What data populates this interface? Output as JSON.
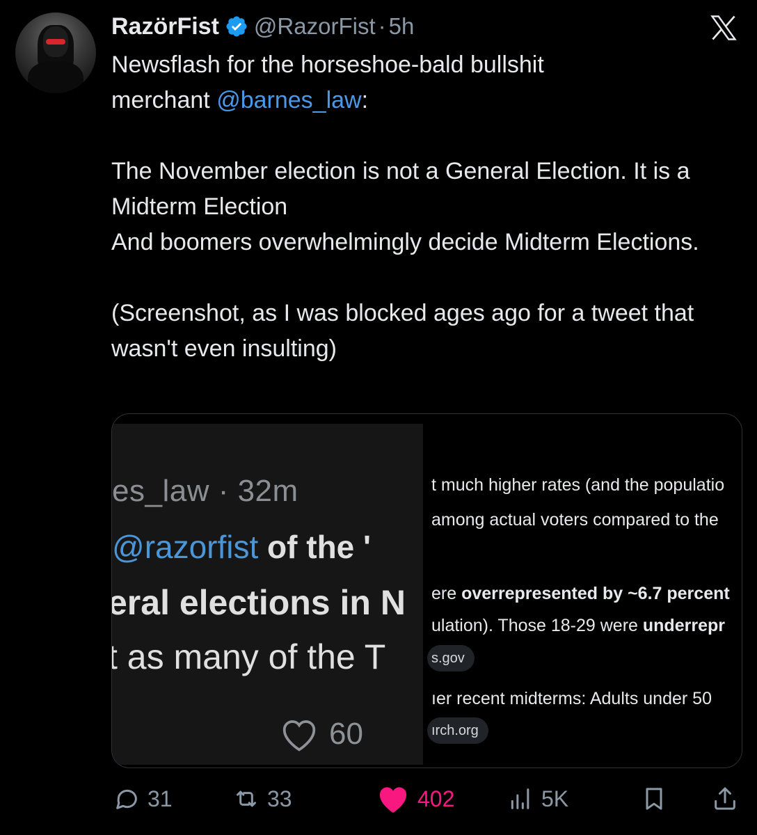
{
  "tweet": {
    "author_name": "RazörFist",
    "handle": "@RazorFist",
    "separator": "·",
    "time": "5h",
    "text": {
      "line1_start": "Newsflash for the horseshoe-bald bullshit",
      "line2_start": "merchant ",
      "mention": "@barnes_law",
      "line2_end": ":",
      "para2": "The November election is not a General Election. It is a Midterm Election",
      "para3": "And boomers overwhelmingly decide Midterm Elections.",
      "para4": "(Screenshot, as I was blocked ages ago for a tweet that wasn't even insulting)"
    }
  },
  "media": {
    "left": {
      "handle_time": "es_law · 32m",
      "mention": "@razorfist",
      "line2_rest": " of the '",
      "line3": "eral elections in N",
      "line4": "t as many of the T",
      "like_count": "60"
    },
    "right": {
      "l1": "t much higher rates (and the populatio",
      "l2": "among actual voters compared to the",
      "l3_a": "ere ",
      "l3_b": "overrepresented by ~6.7 percent",
      "l4_a": "ulation). Those 18-29 were ",
      "l4_b": "underrepr",
      "pill1": "s.gov",
      "l5": "ıer recent midterms: Adults under 50",
      "pill2": "ırch.org"
    }
  },
  "actions": {
    "replies": "31",
    "reposts": "33",
    "likes": "402",
    "views": "5K"
  },
  "icons": {
    "verified": "verified-badge-icon",
    "logo": "x-logo-icon",
    "reply": "reply-icon",
    "repost": "repost-icon",
    "like": "heart-icon",
    "views": "views-icon",
    "bookmark": "bookmark-icon",
    "share": "share-icon"
  },
  "colors": {
    "background": "#000000",
    "text": "#e7e9ea",
    "muted": "#8b98a5",
    "link": "#4a99e9",
    "verified": "#1d9bf0",
    "like": "#f91880"
  }
}
